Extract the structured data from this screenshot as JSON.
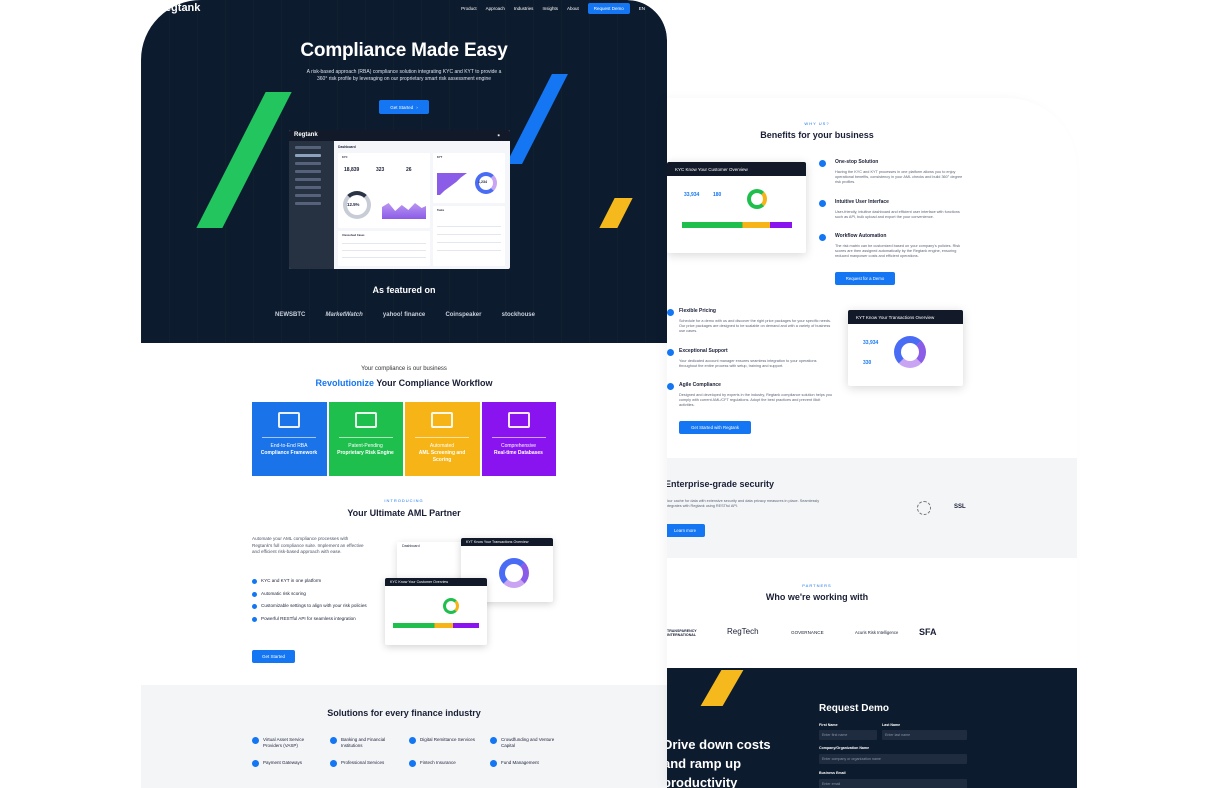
{
  "nav": {
    "logo": "Regtank",
    "links": [
      "Product",
      "Approach",
      "Industries",
      "Insights",
      "About"
    ],
    "cta": "Request Demo",
    "lang": "EN"
  },
  "hero": {
    "title": "Compliance Made Easy",
    "subtitle": "A risk-based approach (RBA) compliance solution integrating KYC and KYT to provide a 360° risk profile by leveraging on our proprietary smart risk assessment engine",
    "button": "Get Started",
    "featured": "As featured on",
    "media": [
      "NEWSBTC",
      "MarketWatch",
      "yahoo! finance",
      "Coinspeaker",
      "stockhouse"
    ]
  },
  "dashboard": {
    "brand": "Regtank",
    "title": "Dashboard",
    "section_kyc": "KYC",
    "section_kyt": "KYT",
    "kpis": [
      "18,839",
      "323",
      "26"
    ],
    "score": "12.5%",
    "kyt_total": "1,234",
    "tasks_label": "Tasks",
    "unresolved_label": "Unresolved Cases"
  },
  "revolution": {
    "kicker": "Your compliance is our business",
    "title_highlight": "Revolutionize",
    "title_rest": " Your Compliance Workflow",
    "tiles": [
      {
        "pre": "End-to-End RBA",
        "bold": "Compliance Framework",
        "color": "#1a73e8"
      },
      {
        "pre": "Patent-Pending",
        "bold": "Proprietary Risk Engine",
        "color": "#1fbf4e"
      },
      {
        "pre": "Automated",
        "bold": "AML Screening and Scoring",
        "color": "#f6b417"
      },
      {
        "pre": "Comprehensive",
        "bold": "Real-time Databases",
        "color": "#8a14f0"
      }
    ]
  },
  "introducing": {
    "kicker": "INTRODUCING",
    "title": "Your Ultimate AML Partner",
    "para": "Automate your AML compliance processes with Regtank's full compliance suite. Implement an effective and efficient risk-based approach with ease.",
    "checks": [
      "KYC and KYT in one platform",
      "Automatic risk scoring",
      "Customizable settings to align with your risk policies",
      "Powerful RESTful API for seamless integration"
    ],
    "button": "Get Started",
    "shot_kyt": "KYT Know Your Transactions Overview",
    "shot_kyc": "KYC Know Your Customer Overview",
    "shot_dash": "Dashboard"
  },
  "solutions": {
    "title": "Solutions for every finance industry",
    "items": [
      "Virtual Asset Service Providers (VASP)",
      "Banking and Financial Institutions",
      "Digital Remittance Services",
      "Crowdfunding and Venture Capital",
      "Payment Gateways",
      "Professional Services",
      "Fintech Insurance",
      "Fund Management"
    ]
  },
  "benefits": {
    "kicker": "WHY US?",
    "title": "Benefits for your business",
    "panel1": "KYC Know Your Customer Overview",
    "panel2": "KYT Know Your Transactions Overview",
    "panel1_values": [
      "33,934",
      "180"
    ],
    "panel2_values": [
      "33,934",
      "330"
    ],
    "features": [
      {
        "title": "One-stop Solution",
        "desc": "Having the KYC and KYT processes in one platform allows you to enjoy operational benefits, consistency in your AML checks and build 360° degree risk profiles."
      },
      {
        "title": "Intuitive User Interface",
        "desc": "User-friendly, intuitive dashboard and efficient user interface with functions such as API, bulk upload and export the your convenience."
      },
      {
        "title": "Workflow Automation",
        "desc": "The risk matrix can be customized based on your company's policies. Risk scores are then assigned automatically by the Regtank engine, ensuring reduced manpower costs and efficient operations."
      },
      {
        "title": "Flexible Pricing",
        "desc": "Schedule for a demo with us and discover the right price packages for your specific needs. Our price packages are designed to be scalable on demand and with a variety of business use cases."
      },
      {
        "title": "Exceptional Support",
        "desc": "Your dedicated account manager ensures seamless integration to your operations throughout the entire process with setup, training and support."
      },
      {
        "title": "Agile Compliance",
        "desc": "Designed and developed by experts in the industry, Regtank compliance solution helps you comply with current AML/CFT regulations. Adopt the best practices and prevent illicit activities."
      }
    ],
    "demo_button": "Request for a Demo",
    "start_button": "Get Started with Regtank"
  },
  "security": {
    "title": "Enterprise-grade security",
    "desc": "Your cache for data with extensive security and data privacy measures in place. Seamlessly integrates with Regtank using RESTful API.",
    "button": "Learn more",
    "badge": "SSL"
  },
  "partners": {
    "kicker": "PARTNERS",
    "title": "Who we're working with",
    "list": [
      "TRANSPARENCY INTERNATIONAL",
      "RegTech",
      "GOVERNANCE",
      "Acuris Risk Intelligence",
      "SFA"
    ]
  },
  "demo": {
    "title": "Request Demo",
    "headline_1": "Drive down costs",
    "headline_2": "and ramp up",
    "headline_3": "productivity",
    "first_label": "First Name",
    "first_ph": "Enter first name",
    "last_label": "Last Name",
    "last_ph": "Enter last name",
    "org_label": "Company/Organization Name",
    "org_ph": "Enter company or organization name",
    "email_label": "Business Email",
    "email_ph": "Enter email"
  }
}
